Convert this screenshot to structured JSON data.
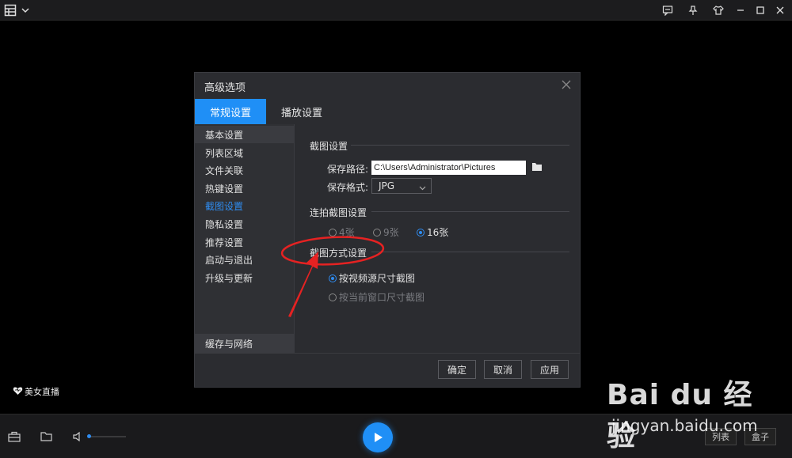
{
  "bottom": {
    "live_label": "美女直播",
    "list_button": "列表",
    "box_button": "盒子"
  },
  "dialog": {
    "title": "高级选项",
    "tabs": [
      "常规设置",
      "播放设置"
    ],
    "sidebar": [
      "基本设置",
      "列表区域",
      "文件关联",
      "热键设置",
      "截图设置",
      "隐私设置",
      "推荐设置",
      "启动与退出",
      "升级与更新"
    ],
    "sidebar_bottom": "缓存与网络",
    "screenshot_section": {
      "title": "截图设置",
      "path_label": "保存路径:",
      "path_value": "C:\\Users\\Administrator\\Pictures",
      "format_label": "保存格式:",
      "format_value": "JPG"
    },
    "burst_section": {
      "title": "连拍截图设置",
      "options": [
        "4张",
        "9张",
        "16张"
      ],
      "selected": "16张"
    },
    "mode_section": {
      "title": "截图方式设置",
      "options": [
        "按视频源尺寸截图",
        "按当前窗口尺寸截图"
      ],
      "selected": "按视频源尺寸截图"
    },
    "buttons": {
      "ok": "确定",
      "cancel": "取消",
      "apply": "应用"
    }
  },
  "watermark": {
    "main": "Bai du 经验",
    "sub": "jingyan.baidu.com"
  },
  "colors": {
    "accent": "#1f8ff6",
    "annotation": "#e52222"
  }
}
